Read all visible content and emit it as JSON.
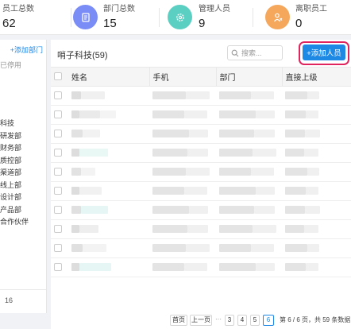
{
  "stats": [
    {
      "label": "员工总数",
      "value": "62",
      "icon": "people-icon",
      "color": ""
    },
    {
      "label": "部门总数",
      "value": "15",
      "icon": "document-icon",
      "color": "#7a8cf5"
    },
    {
      "label": "管理人员",
      "value": "9",
      "icon": "gear-icon",
      "color": "#5ccfc3"
    },
    {
      "label": "离职员工",
      "value": "0",
      "icon": "person-leave-icon",
      "color": "#f5a85c"
    }
  ],
  "left": {
    "add_dept": "+添加部门",
    "disabled": "已停用",
    "departments": [
      "科技",
      "研发部",
      "财务部",
      "质控部",
      "渠道部",
      "线上部",
      "设计部",
      "产品部",
      "合作伙伴"
    ],
    "footer_count": "16"
  },
  "main": {
    "title": "哨子科技(59)",
    "search_placeholder": "搜索...",
    "add_button": "+添加人员",
    "columns": [
      "姓名",
      "手机",
      "部门",
      "直接上级"
    ],
    "row_count": 10
  },
  "pager": {
    "first": "首页",
    "prev": "上一页",
    "ellipsis": "···",
    "pages": [
      "3",
      "4",
      "5",
      "6"
    ],
    "current": "6",
    "info": "第 6 / 6 页，共 59 条数据"
  },
  "colors": {
    "accent": "#1e88e5",
    "highlight_ring": "#e0245e"
  }
}
